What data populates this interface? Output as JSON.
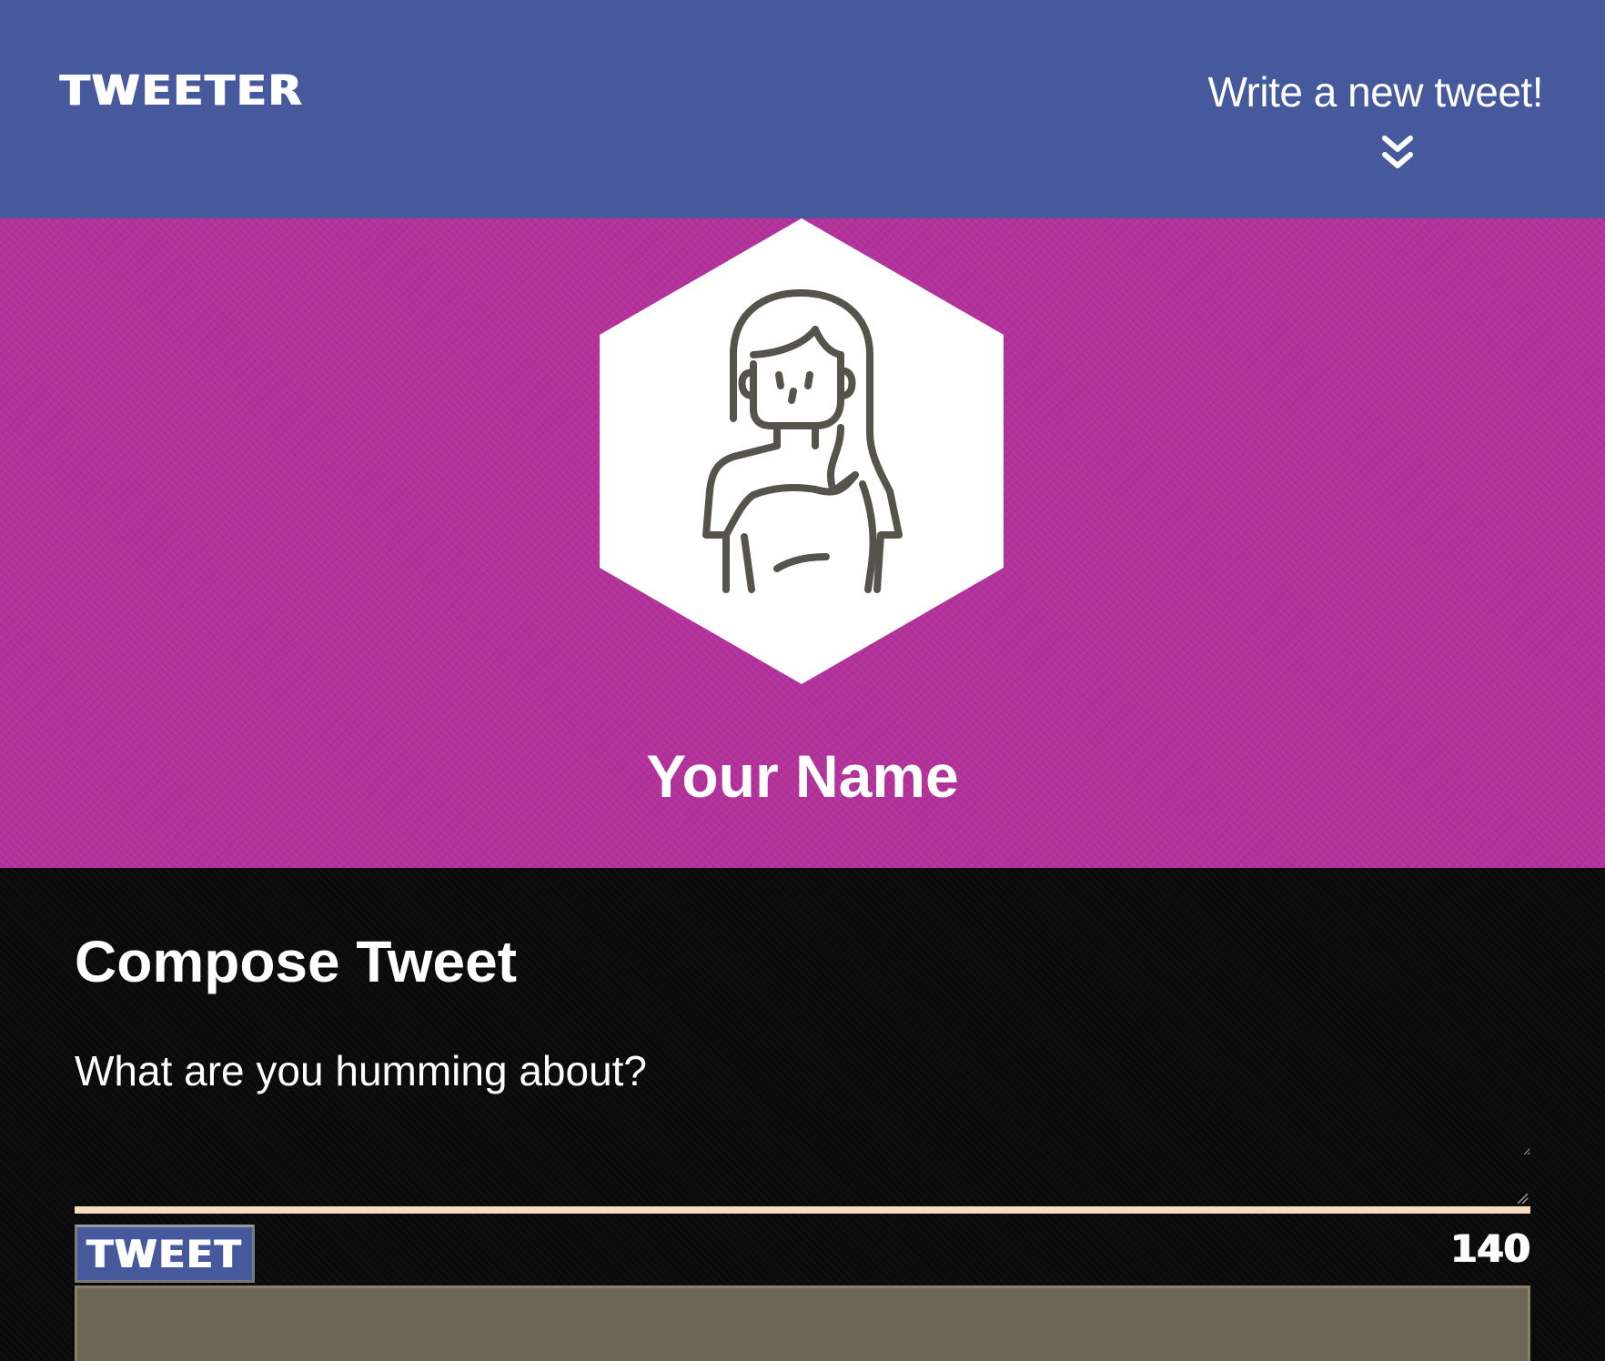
{
  "header": {
    "brand": "TWEETER",
    "new_tweet_label": "Write a new tweet!",
    "new_tweet_icon": "double-chevron-down-icon"
  },
  "profile": {
    "avatar_icon": "person-avatar-icon",
    "name": "Your Name"
  },
  "compose": {
    "title": "Compose Tweet",
    "placeholder": "What are you humming about?",
    "button_label": "TWEET",
    "counter": "140"
  },
  "colors": {
    "header_bg": "#45599c",
    "profile_bg": "#b3319b",
    "compose_bg": "#0a0a0a",
    "underline": "#f3dcc0",
    "tweet_area": "#6e6655"
  }
}
